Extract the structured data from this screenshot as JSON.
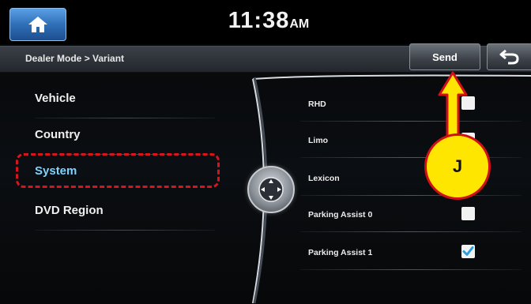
{
  "status": {
    "time": "11:38",
    "ampm": "AM"
  },
  "header": {
    "breadcrumb": "Dealer Mode > Variant",
    "send_label": "Send"
  },
  "menu": {
    "items": [
      {
        "label": "Vehicle",
        "selected": false
      },
      {
        "label": "Country",
        "selected": false
      },
      {
        "label": "System",
        "selected": true
      },
      {
        "label": "DVD Region",
        "selected": false
      }
    ]
  },
  "options": [
    {
      "label": "RHD",
      "checked": false
    },
    {
      "label": "Limo",
      "checked": false
    },
    {
      "label": "Lexicon",
      "checked": false
    },
    {
      "label": "Parking Assist 0",
      "checked": false
    },
    {
      "label": "Parking Assist 1",
      "checked": true
    }
  ],
  "annotation": {
    "label": "J"
  },
  "colors": {
    "accent": "#7fd4ff",
    "highlight": "#d8141c",
    "callout": "#ffe600",
    "check": "#2a9fe0"
  }
}
